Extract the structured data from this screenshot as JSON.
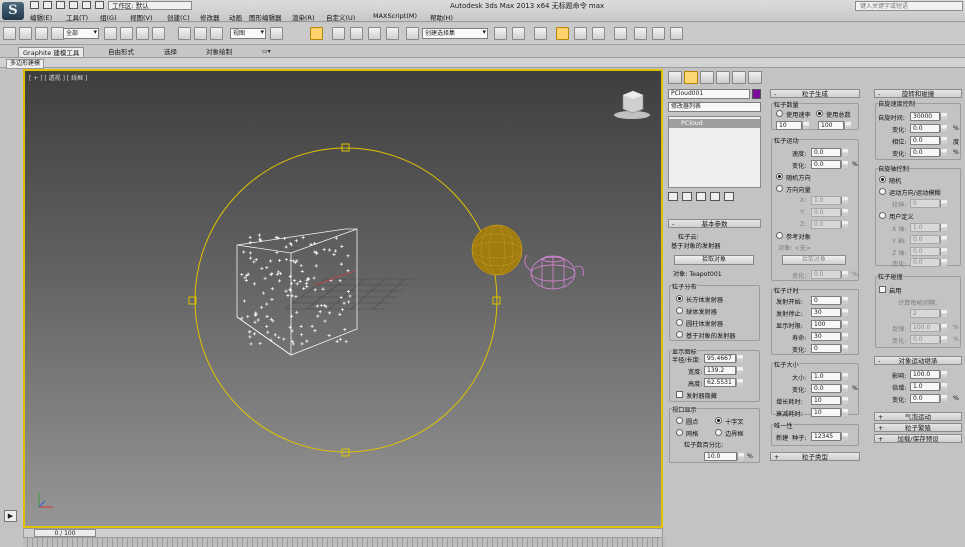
{
  "app": {
    "title": "Autodesk 3ds Max  2013 x64    无标题命令 max",
    "workspace": "工作区: 默认",
    "search_placeholder": "键入关键字或短语"
  },
  "menu": [
    "编辑(E)",
    "工具(T)",
    "组(G)",
    "视图(V)",
    "创建(C)",
    "修改器",
    "动画",
    "图形编辑器",
    "渲染(R)",
    "自定义(U)",
    "MAXScript(M)",
    "帮助(H)"
  ],
  "toolbar": {
    "selection_filter": "全部",
    "view_dropdown": "视图",
    "named_selection": "创建选择集"
  },
  "ribbon": {
    "tabs": [
      "Graphite 建模工具",
      "自由形式",
      "选择",
      "对象绘制"
    ],
    "sub_label": "多边形建模"
  },
  "viewport": {
    "label": "[ + ] [ 透视 ] [ 线框 ]"
  },
  "timeline": {
    "position": "0 / 100"
  },
  "command_panel": {
    "object_name": "PCloud001",
    "modifier_list": "修改器列表",
    "stack_item": "PCloud",
    "basic_params": {
      "header": "基本参数",
      "particle_cloud_label": "粒子云:",
      "emitter_object_label": "基于对象的发射器",
      "pick_object_button": "拾取对象",
      "object_label": "对象: Teapot001",
      "distribution_header": "粒子分布",
      "distribution_options": [
        "长方体发射器",
        "球体发射器",
        "圆柱体发射器",
        "基于对象的发射器"
      ],
      "display_icon_header": "显示图标",
      "radius_label": "半径/长度:",
      "radius_value": "95.4667",
      "width_label": "宽度:",
      "width_value": "139.2",
      "height_label": "高度:",
      "height_value": "62.5531",
      "emitter_hidden_label": "发射器隐藏",
      "viewport_display_header": "视口显示",
      "display_options": [
        "圆点",
        "十字叉",
        "网格",
        "边界框"
      ],
      "percent_label": "粒子数百分比:",
      "percent_value": "10.0",
      "percent_unit": "%"
    },
    "particle_gen": {
      "header": "粒子生成",
      "quantity_header": "粒子数量",
      "use_rate": "使用速率",
      "use_total": "使用总数",
      "rate_value": "10",
      "total_value": "100",
      "motion_header": "粒子运动",
      "speed_label": "速度:",
      "speed_value": "0.0",
      "variation_label": "变化:",
      "variation_value": "0.0",
      "random_direction": "随机方向",
      "direction_vector": "方向向量",
      "x_label": "X:",
      "x_value": "1.0",
      "y_label": "Y:",
      "y_value": "0.0",
      "z_label": "Z:",
      "z_value": "0.0",
      "reference_object": "参考对象",
      "object_none": "对象: <无>",
      "pick_object": "拾取对象",
      "ref_variation_value": "0.0",
      "timing_header": "粒子计时",
      "emit_start_label": "发射开始:",
      "emit_start_value": "0",
      "emit_stop_label": "发射停止:",
      "emit_stop_value": "30",
      "display_until_label": "显示时限:",
      "display_until_value": "100",
      "life_label": "寿命:",
      "life_value": "30",
      "life_variation_label": "变化:",
      "life_variation_value": "0",
      "size_header": "粒子大小",
      "size_label": "大小:",
      "size_value": "1.0",
      "size_variation_label": "变化:",
      "size_variation_value": "0.0",
      "grow_label": "增长耗时:",
      "grow_value": "10",
      "fade_label": "衰减耗时:",
      "fade_value": "10",
      "unique_header": "唯一性",
      "new_label": "新建",
      "seed_label": "种子:",
      "seed_value": "12345",
      "particle_type": "粒子类型"
    },
    "rotation": {
      "header": "旋转和碰撞",
      "auto_spin_header": "自旋速度控制",
      "spin_time_label": "自旋时间:",
      "spin_time_value": "30000",
      "variation_label": "变化:",
      "variation_value": "0.0",
      "phase_label": "相位:",
      "phase_value": "0.0",
      "phase_unit": "度",
      "phase_var_label": "变化:",
      "phase_var_value": "0.0",
      "axis_header": "自旋轴控制",
      "random": "随机",
      "motion_blur": "运动方向/运动模糊",
      "stretch_label": "拉伸:",
      "stretch_value": "0",
      "user_defined": "用户定义",
      "x_axis_label": "X 轴:",
      "x_axis_value": "1.0",
      "y_axis_label": "Y 轴:",
      "y_axis_value": "0.0",
      "z_axis_label": "Z 轴:",
      "z_axis_value": "0.0",
      "axis_var_label": "变化:",
      "axis_var_value": "0.0",
      "collision_header": "粒子碰撞",
      "enable": "启用",
      "calc_label": "计算每帧间隔:",
      "calc_value": "2",
      "bounce_label": "反弹:",
      "bounce_value": "100.0",
      "bounce_var_label": "变化:",
      "bounce_var_value": "0.0"
    },
    "inherit": {
      "header": "对象运动继承",
      "influence_label": "影响:",
      "influence_value": "100.0",
      "multiplier_label": "倍增:",
      "multiplier_value": "1.0",
      "variation_label": "变化:",
      "variation_value": "0.0"
    },
    "collapsed": [
      "气泡运动",
      "粒子繁殖",
      "加载/保存预设"
    ],
    "unit_percent": "%"
  }
}
